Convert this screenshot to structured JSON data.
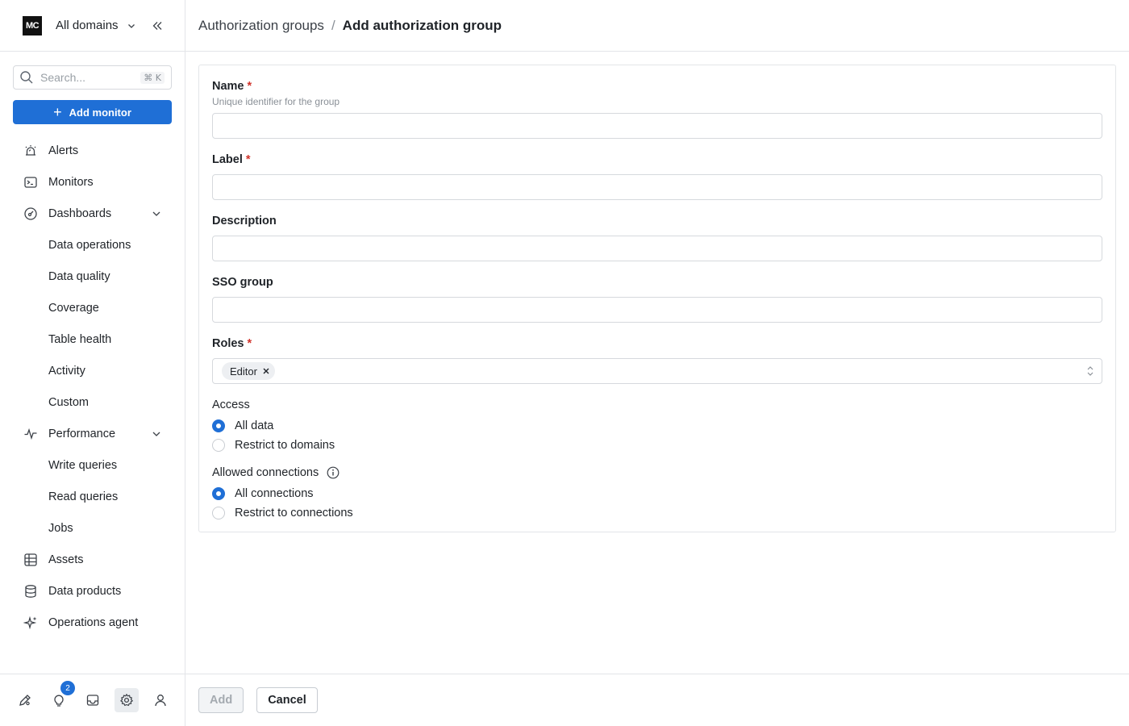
{
  "app": {
    "logo_text": "MC",
    "domain_select": "All domains"
  },
  "sidebar": {
    "search_placeholder": "Search...",
    "search_shortcut": "⌘ K",
    "add_monitor_label": "Add monitor",
    "items": [
      {
        "label": "Alerts",
        "icon": "alert-siren-icon"
      },
      {
        "label": "Monitors",
        "icon": "terminal-icon"
      },
      {
        "label": "Dashboards",
        "icon": "gauge-icon",
        "expanded": true
      },
      {
        "label": "Data operations"
      },
      {
        "label": "Data quality"
      },
      {
        "label": "Coverage"
      },
      {
        "label": "Table health"
      },
      {
        "label": "Activity"
      },
      {
        "label": "Custom"
      },
      {
        "label": "Performance",
        "icon": "pulse-icon",
        "expanded": true
      },
      {
        "label": "Write queries"
      },
      {
        "label": "Read queries"
      },
      {
        "label": "Jobs"
      },
      {
        "label": "Assets",
        "icon": "table-icon"
      },
      {
        "label": "Data products",
        "icon": "database-icon"
      },
      {
        "label": "Operations agent",
        "icon": "sparkle-icon"
      }
    ],
    "bottom": {
      "notification_count": "2",
      "active": "settings"
    }
  },
  "breadcrumb": {
    "parent": "Authorization groups",
    "separator": "/",
    "current": "Add authorization group"
  },
  "form": {
    "name": {
      "label": "Name",
      "hint": "Unique identifier for the group",
      "value": "",
      "required": true
    },
    "label": {
      "label": "Label",
      "value": "",
      "required": true
    },
    "description": {
      "label": "Description",
      "value": ""
    },
    "sso_group": {
      "label": "SSO group",
      "value": ""
    },
    "roles": {
      "label": "Roles",
      "selected": [
        "Editor"
      ],
      "required": true
    },
    "access": {
      "label": "Access",
      "options": [
        "All data",
        "Restrict to domains"
      ],
      "selected": "All data"
    },
    "allowed_connections": {
      "label": "Allowed connections",
      "options": [
        "All connections",
        "Restrict to connections"
      ],
      "selected": "All connections"
    }
  },
  "footer": {
    "add_label": "Add",
    "cancel_label": "Cancel"
  },
  "colors": {
    "accent": "#1f6fd6",
    "required": "#d0342c",
    "border": "#e3e5e8"
  }
}
